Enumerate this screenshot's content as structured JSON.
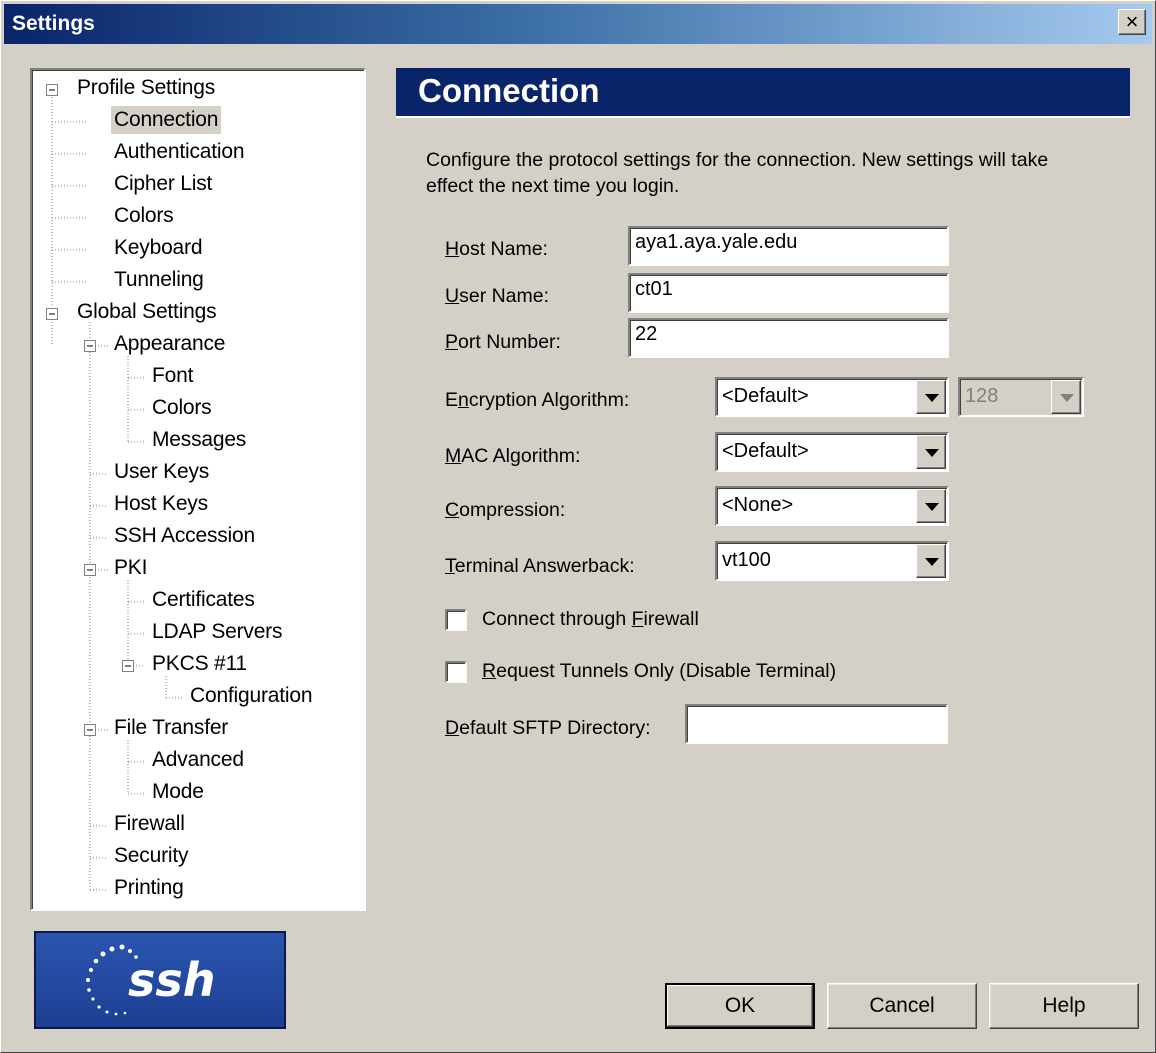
{
  "window": {
    "title": "Settings",
    "close_glyph": "×"
  },
  "tree": {
    "profile_settings": "Profile Settings",
    "connection": "Connection",
    "authentication": "Authentication",
    "cipher_list": "Cipher List",
    "colors": "Colors",
    "keyboard": "Keyboard",
    "tunneling": "Tunneling",
    "global_settings": "Global Settings",
    "appearance": "Appearance",
    "font": "Font",
    "appearance_colors": "Colors",
    "messages": "Messages",
    "user_keys": "User Keys",
    "host_keys": "Host Keys",
    "ssh_accession": "SSH Accession",
    "pki": "PKI",
    "certificates": "Certificates",
    "ldap_servers": "LDAP Servers",
    "pkcs11": "PKCS #11",
    "configuration": "Configuration",
    "file_transfer": "File Transfer",
    "advanced": "Advanced",
    "mode": "Mode",
    "firewall": "Firewall",
    "security": "Security",
    "printing": "Printing",
    "selected": "Connection"
  },
  "logo": {
    "text": "ssh"
  },
  "panel": {
    "title": "Connection",
    "description": "Configure the protocol settings for the connection. New settings will take effect the next time you login."
  },
  "form": {
    "host_name": {
      "label_accel": "H",
      "label_rest": "ost Name:",
      "value": "aya1.aya.yale.edu"
    },
    "user_name": {
      "label_accel": "U",
      "label_rest": "ser Name:",
      "value": "ct01"
    },
    "port_number": {
      "label_accel": "P",
      "label_rest": "ort Number:",
      "value": "22"
    },
    "encryption": {
      "label_pre": "E",
      "label_accel": "n",
      "label_rest": "cryption Algorithm:",
      "value": "<Default>",
      "key_length": "128"
    },
    "mac": {
      "label_accel": "M",
      "label_rest": "AC Algorithm:",
      "value": "<Default>"
    },
    "compression": {
      "label_accel": "C",
      "label_rest": "ompression:",
      "value": "<None>"
    },
    "terminal_answerback": {
      "label_accel": "T",
      "label_rest": "erminal Answerback:",
      "value": "vt100"
    },
    "connect_firewall": {
      "label_pre": "Connect through ",
      "label_accel": "F",
      "label_rest": "irewall",
      "checked": false
    },
    "request_tunnels": {
      "label_accel": "R",
      "label_rest": "equest Tunnels Only (Disable Terminal)",
      "checked": false
    },
    "sftp_dir": {
      "label_accel": "D",
      "label_rest": "efault SFTP Directory:",
      "value": ""
    }
  },
  "buttons": {
    "ok": "OK",
    "cancel": "Cancel",
    "help": "Help"
  }
}
